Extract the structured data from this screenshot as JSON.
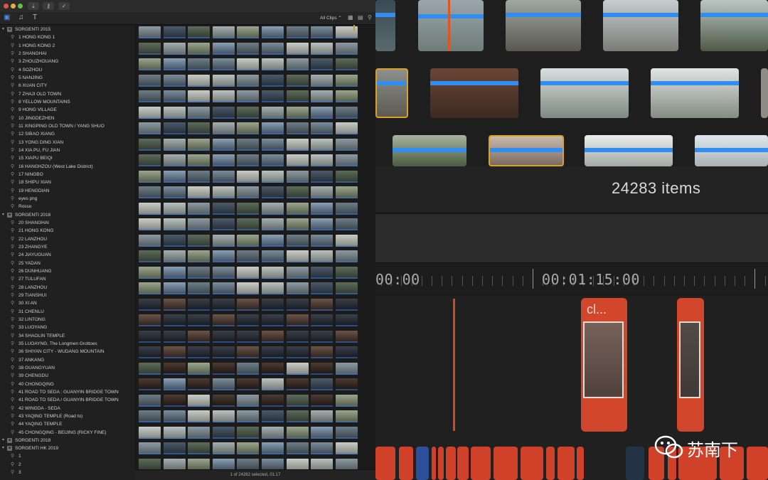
{
  "library": {
    "window_buttons": {
      "close": "#e2524c",
      "minimize": "#e0b33e",
      "zoom": "#5ec245"
    },
    "toolbar": {
      "filter_label": "All Clips"
    },
    "status_text": "1 of 24282 selected, 01:17",
    "sidebar": [
      {
        "type": "library",
        "label": "SORGENTI 2015"
      },
      {
        "type": "event",
        "label": "1 HONG KONG 1"
      },
      {
        "type": "event",
        "label": "1 HONG KONG 2"
      },
      {
        "type": "event",
        "label": "2 SHANGHAI"
      },
      {
        "type": "event",
        "label": "3 ZHOUZHOUANG"
      },
      {
        "type": "event",
        "label": "4 SOZHOU"
      },
      {
        "type": "event",
        "label": "5 NANJING"
      },
      {
        "type": "event",
        "label": "6 XUAN CITY"
      },
      {
        "type": "event",
        "label": "7 ZHAJI OLD TOWN"
      },
      {
        "type": "event",
        "label": "8 YELLOW MOUNTAINS"
      },
      {
        "type": "event",
        "label": "9 HONG VILLAGE"
      },
      {
        "type": "event",
        "label": "10 JINGDEZHEN"
      },
      {
        "type": "event",
        "label": "11 XINGPING OLD TOWN / YANG SHUO"
      },
      {
        "type": "event",
        "label": "12 SIBAO XIANG"
      },
      {
        "type": "event",
        "label": "13 YONG DING XIAN"
      },
      {
        "type": "event",
        "label": "14 XIA PU, FU JIAN"
      },
      {
        "type": "event",
        "label": "15 XIAPU BEIQI"
      },
      {
        "type": "event",
        "label": "16 HANGHZOU (West Lake District)"
      },
      {
        "type": "event",
        "label": "17 NINGBO"
      },
      {
        "type": "event",
        "label": "18 SHIPU XIAN"
      },
      {
        "type": "event",
        "label": "19 HENGDIAN"
      },
      {
        "type": "event",
        "label": "eyes png"
      },
      {
        "type": "event",
        "label": "Rosso"
      },
      {
        "type": "library",
        "label": "SORGENTI 2016"
      },
      {
        "type": "event",
        "label": "20 SHANGHAI"
      },
      {
        "type": "event",
        "label": "21 HONG KONG"
      },
      {
        "type": "event",
        "label": "22 LANZHOU"
      },
      {
        "type": "event",
        "label": "23 ZHANGYE"
      },
      {
        "type": "event",
        "label": "24 JIAYUGUAN"
      },
      {
        "type": "event",
        "label": "25 YADAN"
      },
      {
        "type": "event",
        "label": "26 DUNHUANG"
      },
      {
        "type": "event",
        "label": "27 TULUFAN"
      },
      {
        "type": "event",
        "label": "28 LANZHOU"
      },
      {
        "type": "event",
        "label": "29 TIANSHUI"
      },
      {
        "type": "event",
        "label": "30 XI AN"
      },
      {
        "type": "event",
        "label": "31 CHENLU"
      },
      {
        "type": "event",
        "label": "32 LINTONG"
      },
      {
        "type": "event",
        "label": "33 LUOYANG"
      },
      {
        "type": "event",
        "label": "34 SHAOLIN TEMPLE"
      },
      {
        "type": "event",
        "label": "35 LUOAYNG, The Longmen Grottoes"
      },
      {
        "type": "event",
        "label": "36 SHIYAN CITY - WUDANG MOUNTAIN"
      },
      {
        "type": "event",
        "label": "37 ANKANG"
      },
      {
        "type": "event",
        "label": "38 GUANGYUAN"
      },
      {
        "type": "event",
        "label": "39 CHENGDU"
      },
      {
        "type": "event",
        "label": "40 CHONGQING"
      },
      {
        "type": "event",
        "label": "41 ROAD TO SEDA : GUANYIN BRIDGE TOWN"
      },
      {
        "type": "event",
        "label": "41 ROAD TO SEDA / GUANYIN BRIDGE TOWN"
      },
      {
        "type": "event",
        "label": "42 WINGDA - SEDA"
      },
      {
        "type": "event",
        "label": "43 YAQING TEMPLE (Road to)"
      },
      {
        "type": "event",
        "label": "44 YAQING TEMPLE"
      },
      {
        "type": "event",
        "label": "45 CHONGQING - BEIJING (RICKY FINE)"
      },
      {
        "type": "library",
        "label": "SORGENTI 2018"
      },
      {
        "type": "library",
        "label": "SORGENTI HK 2019"
      },
      {
        "type": "event",
        "label": "1"
      },
      {
        "type": "event",
        "label": "2"
      },
      {
        "type": "event",
        "label": "3"
      }
    ]
  },
  "editor": {
    "items_count": "24283 items",
    "timecode_left": "00:00",
    "timecode_main": "00:01:15:00",
    "clip_title": "cl..."
  },
  "watermark": {
    "text": "苏南下"
  }
}
